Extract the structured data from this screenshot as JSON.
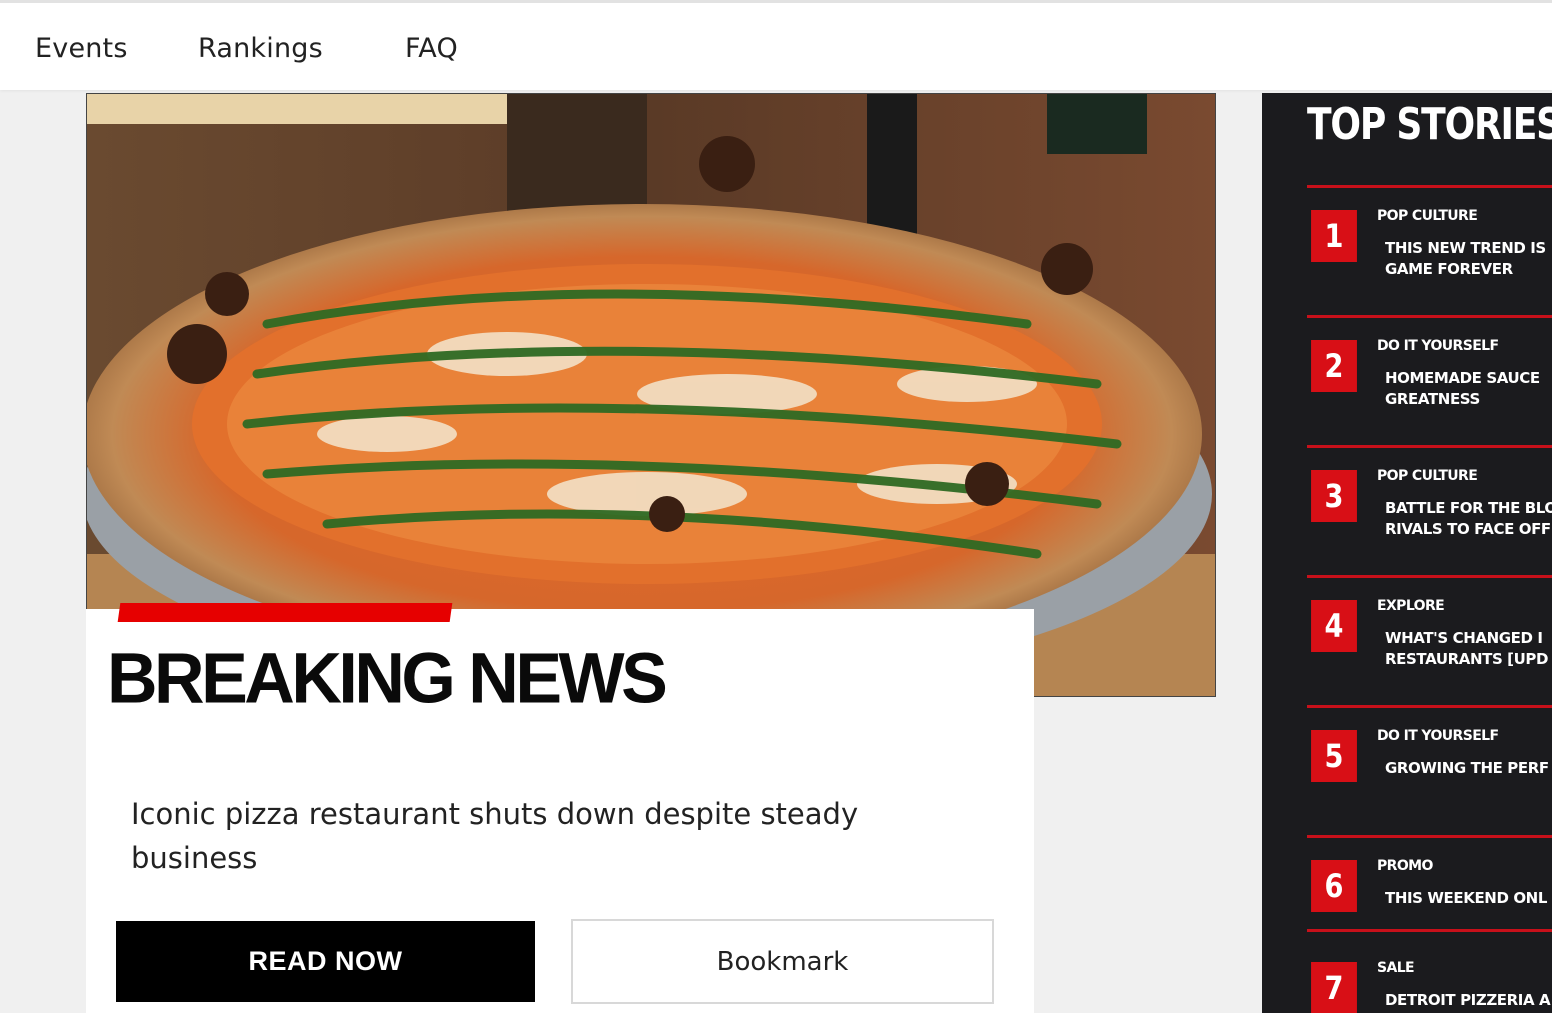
{
  "nav": {
    "items": [
      {
        "label": "Events"
      },
      {
        "label": "Rankings"
      },
      {
        "label": "FAQ"
      }
    ]
  },
  "hero": {
    "image_icon": "pizza-photo",
    "headline": "BREAKING NEWS",
    "subtitle": "Iconic pizza restaurant shuts down despite steady business",
    "read_label": "READ NOW",
    "bookmark_label": "Bookmark"
  },
  "sidebar": {
    "title": "TOP STORIES",
    "stories": [
      {
        "rank": "1",
        "category": "POP CULTURE",
        "title": "THIS NEW TREND IS\nGAME FOREVER"
      },
      {
        "rank": "2",
        "category": "DO IT YOURSELF",
        "title": "HOMEMADE SAUCE\nGREATNESS"
      },
      {
        "rank": "3",
        "category": "POP CULTURE",
        "title": "BATTLE FOR THE BLO\nRIVALS TO FACE OFF"
      },
      {
        "rank": "4",
        "category": "EXPLORE",
        "title": "WHAT'S CHANGED I\nRESTAURANTS [UPD"
      },
      {
        "rank": "5",
        "category": "DO IT YOURSELF",
        "title": "GROWING THE PERF"
      },
      {
        "rank": "6",
        "category": "PROMO",
        "title": "THIS WEEKEND ONL"
      },
      {
        "rank": "7",
        "category": "SALE",
        "title": "DETROIT PIZZERIA A\nSPECIAL"
      }
    ]
  },
  "colors": {
    "accent_red": "#e60000",
    "sidebar_bg": "#1b1b1e",
    "button_black": "#000000"
  }
}
